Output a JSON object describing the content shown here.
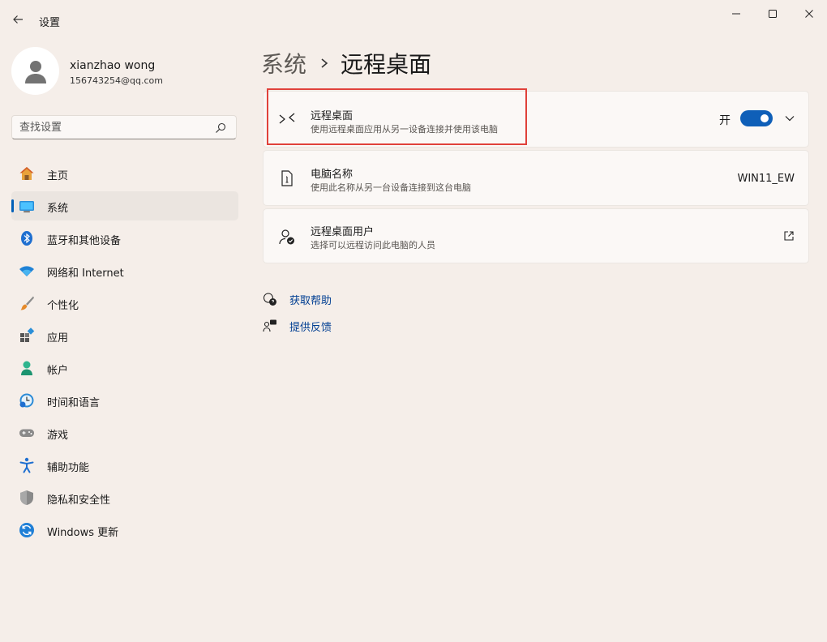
{
  "window": {
    "app_title": "设置"
  },
  "profile": {
    "name": "xianzhao wong",
    "email": "156743254@qq.com"
  },
  "search": {
    "placeholder": "查找设置"
  },
  "sidebar": {
    "items": [
      {
        "label": "主页",
        "icon": "home-icon"
      },
      {
        "label": "系统",
        "icon": "system-icon",
        "active": true
      },
      {
        "label": "蓝牙和其他设备",
        "icon": "bluetooth-icon"
      },
      {
        "label": "网络和 Internet",
        "icon": "wifi-icon"
      },
      {
        "label": "个性化",
        "icon": "brush-icon"
      },
      {
        "label": "应用",
        "icon": "apps-icon"
      },
      {
        "label": "帐户",
        "icon": "account-icon"
      },
      {
        "label": "时间和语言",
        "icon": "time-language-icon"
      },
      {
        "label": "游戏",
        "icon": "gamepad-icon"
      },
      {
        "label": "辅助功能",
        "icon": "accessibility-icon"
      },
      {
        "label": "隐私和安全性",
        "icon": "shield-icon"
      },
      {
        "label": "Windows 更新",
        "icon": "update-icon"
      }
    ]
  },
  "header": {
    "parent": "系统",
    "current": "远程桌面"
  },
  "cards": {
    "remote_desktop": {
      "title": "远程桌面",
      "description": "使用远程桌面应用从另一设备连接并使用该电脑",
      "toggle_label": "开",
      "toggle_on": true
    },
    "pc_name": {
      "title": "电脑名称",
      "description": "使用此名称从另一台设备连接到这台电脑",
      "value": "WIN11_EW"
    },
    "remote_users": {
      "title": "远程桌面用户",
      "description": "选择可以远程访问此电脑的人员"
    }
  },
  "help": {
    "get_help": "获取帮助",
    "feedback": "提供反馈"
  },
  "colors": {
    "accent": "#005fb8",
    "highlight": "#e0413a",
    "link": "#003e92"
  }
}
